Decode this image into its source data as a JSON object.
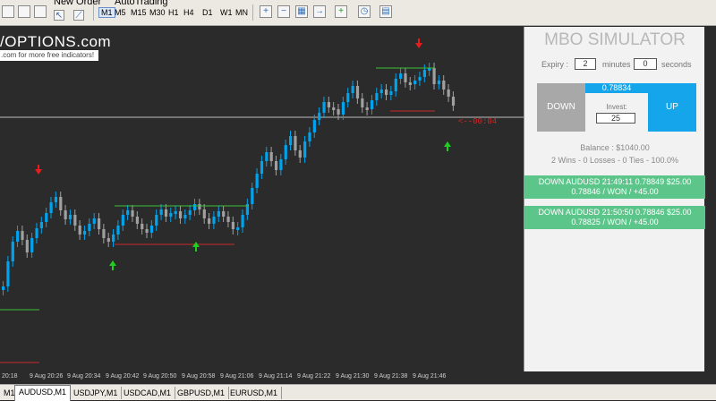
{
  "toolbar": {
    "new_order": "New Order",
    "auto_trading": "AutoTrading",
    "timeframes": [
      "M1",
      "M5",
      "M15",
      "M30",
      "H1",
      "H4",
      "D1",
      "W1",
      "MN"
    ],
    "selected_timeframe": "M1"
  },
  "chart": {
    "logo_text": "/OPTIONS.com",
    "logo_sub": ".com for more free indicators!",
    "countdown": "<--00:04",
    "x_labels": [
      "20:18",
      "9 Aug 20:26",
      "9 Aug 20:34",
      "9 Aug 20:42",
      "9 Aug 20:50",
      "9 Aug 20:58",
      "9 Aug 21:06",
      "9 Aug 21:14",
      "9 Aug 21:22",
      "9 Aug 21:30",
      "9 Aug 21:38",
      "9 Aug 21:46"
    ]
  },
  "simulator": {
    "title": "MBO SIMULATOR",
    "expiry_label": "Expiry :",
    "expiry_minutes": "2",
    "minutes_label": "minutes",
    "expiry_seconds": "0",
    "seconds_label": "seconds",
    "down_label": "DOWN",
    "up_label": "UP",
    "price": "0.78834",
    "invest_label": "Invest:",
    "invest_value": "25",
    "balance": "Balance : $1040.00",
    "stats": "2 Wins - 0 Losses - 0 Ties - 100.0%",
    "trades": [
      {
        "line1": "DOWN AUDUSD 21:49:11 0.78849 $25.00",
        "line2": "0.78846 / WON / +45.00"
      },
      {
        "line1": "DOWN AUDUSD 21:50:50 0.78846 $25.00",
        "line2": "0.78825 / WON / +45.00"
      }
    ]
  },
  "tabs": [
    "M1",
    "AUDUSD,M1",
    "USDJPY,M1",
    "USDCAD,M1",
    "GBPUSD,M1",
    "EURUSD,M1"
  ],
  "active_tab": "AUDUSD,M1",
  "colors": {
    "bull": "#00a3ee",
    "bear": "#a0a0a0",
    "win_bg": "#5bc58a",
    "up_btn": "#14a5ea",
    "down_arrow": "#e81c1c",
    "up_arrow": "#1ed01e"
  }
}
